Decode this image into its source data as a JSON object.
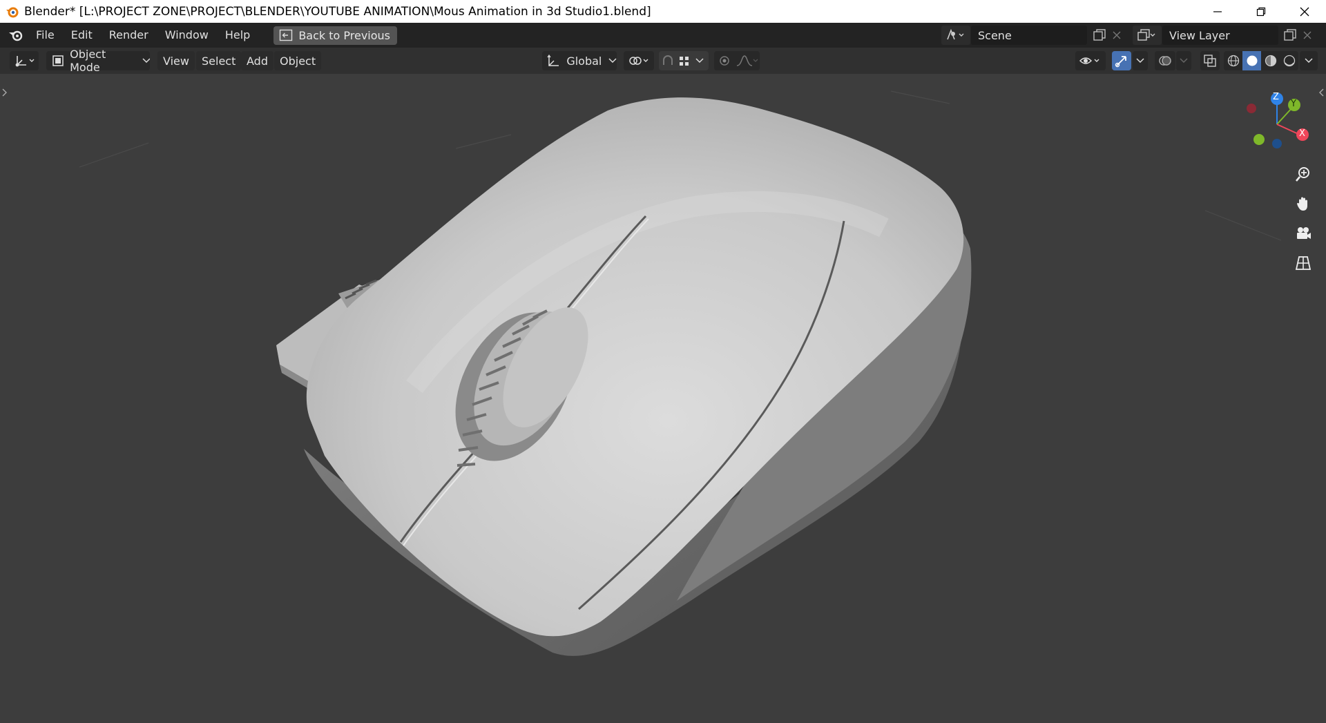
{
  "window": {
    "title": "Blender* [L:\\PROJECT ZONE\\PROJECT\\BLENDER\\YOUTUBE ANIMATION\\Mous Animation in 3d Studio1.blend]"
  },
  "menu": {
    "items": [
      {
        "label": "File"
      },
      {
        "label": "Edit"
      },
      {
        "label": "Render"
      },
      {
        "label": "Window"
      },
      {
        "label": "Help"
      }
    ],
    "back_label": "Back to Previous"
  },
  "scene": {
    "name": "Scene"
  },
  "view_layer": {
    "name": "View Layer"
  },
  "header": {
    "mode": "Object Mode",
    "menus": [
      {
        "label": "View"
      },
      {
        "label": "Select"
      },
      {
        "label": "Add"
      },
      {
        "label": "Object"
      }
    ],
    "orientation": "Global"
  },
  "gizmo": {
    "x": "X",
    "y": "Y",
    "z": "Z"
  },
  "colors": {
    "viewport_bg": "#3d3d3d",
    "topbar_bg": "#232323",
    "header_bg": "#303030",
    "accent": "#4772b3",
    "axis_x": "#f0465a",
    "axis_y": "#7fb82a",
    "axis_z": "#2f83e8"
  },
  "icons": [
    "blender-logo-icon",
    "back-icon",
    "scene-icon",
    "view-layer-icon",
    "zoom-icon",
    "hand-icon",
    "camera-icon",
    "grid-icon"
  ]
}
